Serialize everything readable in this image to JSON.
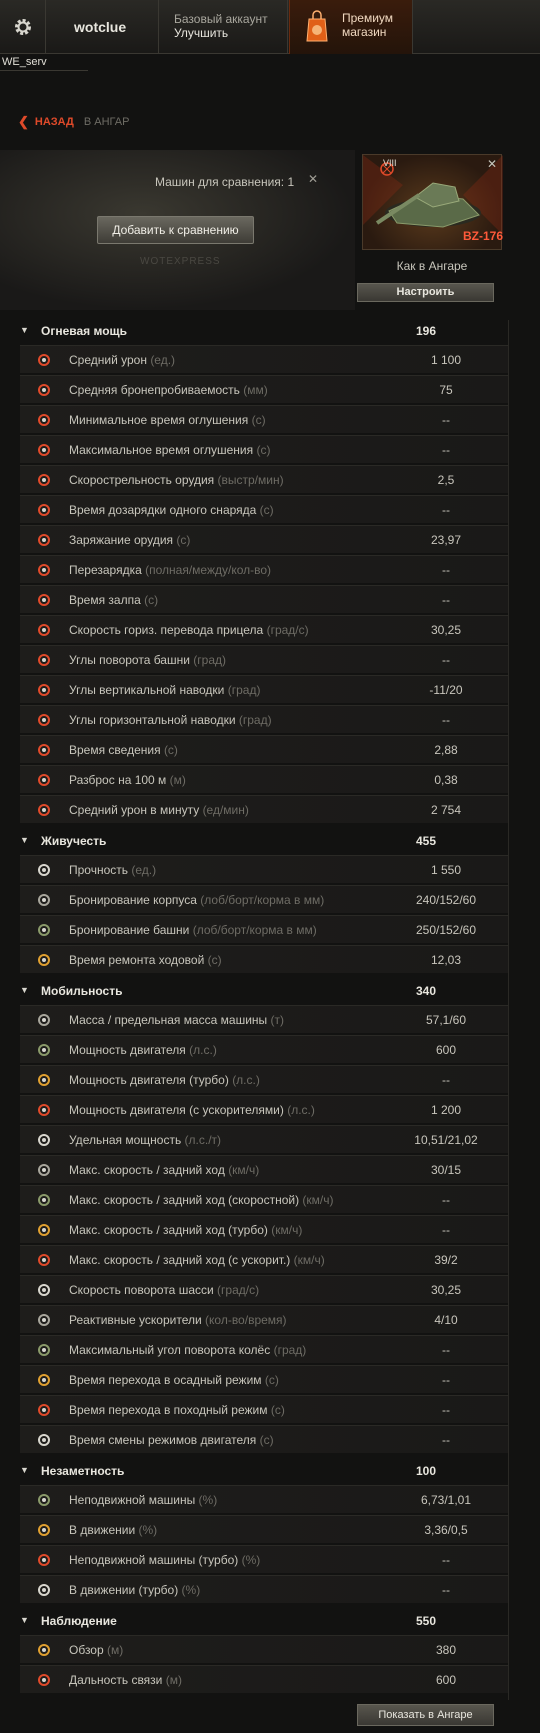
{
  "topbar": {
    "username": "wotclue",
    "account_type": "Базовый аккаунт",
    "upgrade": "Улучшить",
    "premium_line1": "Премиум",
    "premium_line2": "магазин"
  },
  "server": "WE_serv",
  "nav": {
    "back": "НАЗАД",
    "destination": "В АНГАР"
  },
  "compare": {
    "count_label": "Машин для сравнения: 1",
    "add_button": "Добавить к сравнению",
    "watermark": "WOTEXPRESS"
  },
  "tank": {
    "tier": "VIII",
    "name": "BZ-176",
    "status": "Как в Ангаре",
    "setup_button": "Настроить"
  },
  "sections": [
    {
      "title": "Огневая мощь",
      "value": "196",
      "rows": [
        {
          "icon": "damage-icon",
          "label": "Средний урон",
          "unit": "(ед.)",
          "value": "1 100"
        },
        {
          "icon": "penetration-icon",
          "label": "Средняя бронепробиваемость",
          "unit": "(мм)",
          "value": "75"
        },
        {
          "icon": "stun-min-icon",
          "label": "Минимальное время оглушения",
          "unit": "(с)",
          "value": "--"
        },
        {
          "icon": "stun-max-icon",
          "label": "Максимальное время оглушения",
          "unit": "(с)",
          "value": "--"
        },
        {
          "icon": "rate-of-fire-icon",
          "label": "Скорострельность орудия",
          "unit": "(выстр/мин)",
          "value": "2,5"
        },
        {
          "icon": "shell-reload-icon",
          "label": "Время дозарядки одного снаряда",
          "unit": "(с)",
          "value": "--"
        },
        {
          "icon": "reload-icon",
          "label": "Заряжание орудия",
          "unit": "(с)",
          "value": "23,97"
        },
        {
          "icon": "magazine-reload-icon",
          "label": "Перезарядка",
          "unit": "(полная/между/кол-во)",
          "value": "--"
        },
        {
          "icon": "salvo-icon",
          "label": "Время залпа",
          "unit": "(с)",
          "value": "--"
        },
        {
          "icon": "traverse-icon",
          "label": "Скорость гориз. перевода прицела",
          "unit": "(град/с)",
          "value": "30,25"
        },
        {
          "icon": "turret-angles-icon",
          "label": "Углы поворота башни",
          "unit": "(град)",
          "value": "--"
        },
        {
          "icon": "elevation-icon",
          "label": "Углы вертикальной наводки",
          "unit": "(град)",
          "value": "-11/20"
        },
        {
          "icon": "horizontal-aim-icon",
          "label": "Углы горизонтальной наводки",
          "unit": "(град)",
          "value": "--"
        },
        {
          "icon": "aim-time-icon",
          "label": "Время сведения",
          "unit": "(с)",
          "value": "2,88"
        },
        {
          "icon": "dispersion-icon",
          "label": "Разброс на 100 м",
          "unit": "(м)",
          "value": "0,38"
        },
        {
          "icon": "dpm-icon",
          "label": "Средний урон в минуту",
          "unit": "(ед/мин)",
          "value": "2 754"
        }
      ]
    },
    {
      "title": "Живучесть",
      "value": "455",
      "rows": [
        {
          "icon": "hp-icon",
          "label": "Прочность",
          "unit": "(ед.)",
          "value": "1 550"
        },
        {
          "icon": "hull-armor-icon",
          "label": "Бронирование корпуса",
          "unit": "(лоб/борт/корма в мм)",
          "value": "240/152/60"
        },
        {
          "icon": "turret-armor-icon",
          "label": "Бронирование башни",
          "unit": "(лоб/борт/корма в мм)",
          "value": "250/152/60"
        },
        {
          "icon": "repair-icon",
          "label": "Время ремонта ходовой",
          "unit": "(с)",
          "value": "12,03"
        }
      ]
    },
    {
      "title": "Мобильность",
      "value": "340",
      "rows": [
        {
          "icon": "weight-icon",
          "label": "Масса / предельная масса машины",
          "unit": "(т)",
          "value": "57,1/60"
        },
        {
          "icon": "engine-icon",
          "label": "Мощность двигателя",
          "unit": "(л.с.)",
          "value": "600"
        },
        {
          "icon": "engine-turbo-icon",
          "label": "Мощность двигателя (турбо)",
          "unit": "(л.с.)",
          "value": "--"
        },
        {
          "icon": "engine-boost-icon",
          "label": "Мощность двигателя (с ускорителями)",
          "unit": "(л.с.)",
          "value": "1 200"
        },
        {
          "icon": "specific-power-icon",
          "label": "Удельная мощность",
          "unit": "(л.с./т)",
          "value": "10,51/21,02"
        },
        {
          "icon": "speed-icon",
          "label": "Макс. скорость / задний ход",
          "unit": "(км/ч)",
          "value": "30/15"
        },
        {
          "icon": "speed-fast-icon",
          "label": "Макс. скорость / задний ход (скоростной)",
          "unit": "(км/ч)",
          "value": "--"
        },
        {
          "icon": "speed-turbo-icon",
          "label": "Макс. скорость / задний ход (турбо)",
          "unit": "(км/ч)",
          "value": "--"
        },
        {
          "icon": "speed-boost-icon",
          "label": "Макс. скорость / задний ход (с ускорит.)",
          "unit": "(км/ч)",
          "value": "39/2"
        },
        {
          "icon": "chassis-rotation-icon",
          "label": "Скорость поворота шасси",
          "unit": "(град/с)",
          "value": "30,25"
        },
        {
          "icon": "rocket-booster-icon",
          "label": "Реактивные ускорители",
          "unit": "(кол-во/время)",
          "value": "4/10"
        },
        {
          "icon": "wheel-angle-icon",
          "label": "Максимальный угол поворота колёс",
          "unit": "(град)",
          "value": "--"
        },
        {
          "icon": "siege-mode-icon",
          "label": "Время перехода в осадный режим",
          "unit": " (с)",
          "value": "--"
        },
        {
          "icon": "travel-mode-icon",
          "label": "Время перехода в походный режим",
          "unit": " (с)",
          "value": "--"
        },
        {
          "icon": "engine-mode-icon",
          "label": "Время смены режимов двигателя",
          "unit": "(с)",
          "value": "--"
        }
      ]
    },
    {
      "title": "Незаметность",
      "value": "100",
      "rows": [
        {
          "icon": "camo-stationary-icon",
          "label": "Неподвижной машины",
          "unit": "(%)",
          "value": "6,73/1,01"
        },
        {
          "icon": "camo-moving-icon",
          "label": "В движении",
          "unit": "(%)",
          "value": "3,36/0,5"
        },
        {
          "icon": "camo-stationary-turbo-icon",
          "label": "Неподвижной машины (турбо)",
          "unit": "(%)",
          "value": "--"
        },
        {
          "icon": "camo-moving-turbo-icon",
          "label": "В движении (турбо)",
          "unit": "(%)",
          "value": "--"
        }
      ]
    },
    {
      "title": "Наблюдение",
      "value": "550",
      "rows": [
        {
          "icon": "view-range-icon",
          "label": "Обзор",
          "unit": "(м)",
          "value": "380"
        },
        {
          "icon": "radio-range-icon",
          "label": "Дальность связи",
          "unit": "(м)",
          "value": "600"
        }
      ]
    }
  ],
  "footer": {
    "show_in_garage": "Показать в Ангаре"
  },
  "colors": {
    "accent": "#e04a2a",
    "background": "#121211",
    "text": "#c8c6bc",
    "unit": "#6e6c65"
  }
}
